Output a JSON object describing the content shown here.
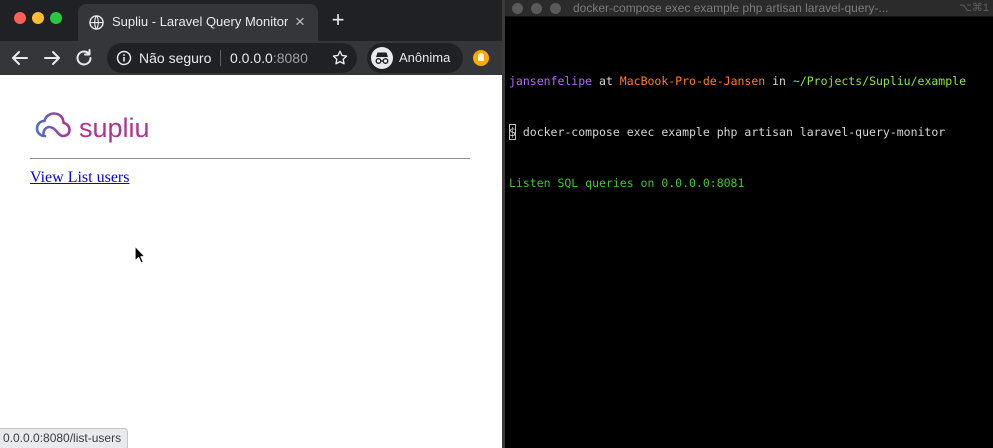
{
  "browser": {
    "tab": {
      "title": "Supliu - Laravel Query Monitor",
      "close_glyph": "×"
    },
    "new_tab_glyph": "+",
    "omnibox": {
      "security_label": "Não seguro",
      "host": "0.0.0.0",
      "port": ":8080"
    },
    "incognito_label": "Anônima",
    "page": {
      "logo_text": "supliu",
      "link_label": "View List users"
    },
    "status_url": "0.0.0.0:8080/list-users"
  },
  "terminal": {
    "title": "docker-compose exec example php artisan laravel-query-...",
    "shortcut": "⌥⌘1",
    "prompt": {
      "user": "jansenfelipe",
      "at": " at ",
      "host": "MacBook-Pro-de-Jansen",
      "in": " in ",
      "path": "~/Projects/Supliu/example"
    },
    "command": "$ docker-compose exec example php artisan laravel-query-monitor",
    "output": "Listen SQL queries on 0.0.0.0:8081"
  },
  "colors": {
    "tab_bg": "#35363a",
    "tabstrip_bg": "#202124",
    "link": "#0000ee",
    "term_user": "#b763ff",
    "term_host": "#ff7b1c",
    "term_path": "#8ee53f",
    "term_output": "#41c52f",
    "logo_gradient": [
      "#4a6fd0",
      "#b0338f"
    ]
  },
  "icons": [
    "globe-icon",
    "back-arrow-icon",
    "forward-arrow-icon",
    "reload-icon",
    "info-icon",
    "star-icon",
    "incognito-icon",
    "extension-icon",
    "cloud-logo-icon",
    "mouse-cursor-icon"
  ]
}
